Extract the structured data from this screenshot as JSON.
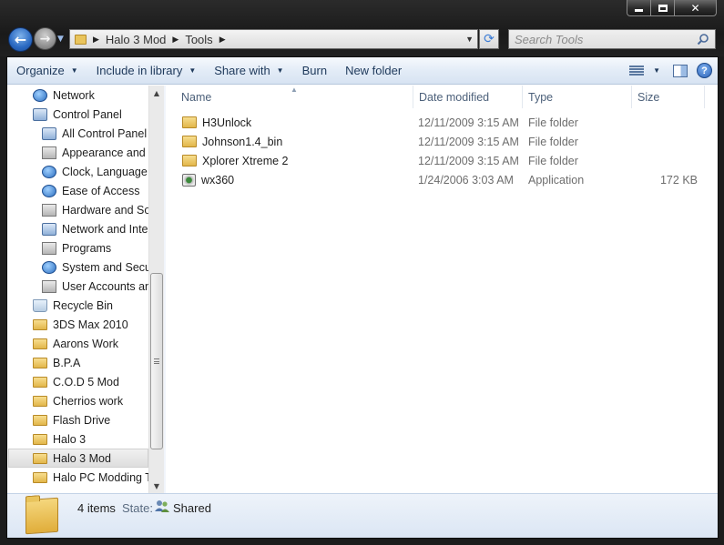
{
  "address": {
    "crumbs": [
      "Halo 3 Mod",
      "Tools"
    ]
  },
  "search": {
    "placeholder": "Search Tools"
  },
  "toolbar": {
    "organize": "Organize",
    "include_in_library": "Include in library",
    "share_with": "Share with",
    "burn": "Burn",
    "new_folder": "New folder"
  },
  "sidebar": {
    "items": [
      {
        "label": "Network",
        "icon": "network-icon"
      },
      {
        "label": "Control Panel",
        "icon": "control-panel-icon"
      },
      {
        "label": "All Control Panel I",
        "icon": "control-panel-icon"
      },
      {
        "label": "Appearance and P",
        "icon": "appearance-icon"
      },
      {
        "label": "Clock, Language,",
        "icon": "clock-icon"
      },
      {
        "label": "Ease of Access",
        "icon": "ease-of-access-icon"
      },
      {
        "label": "Hardware and Sou",
        "icon": "hardware-icon"
      },
      {
        "label": "Network and Inter",
        "icon": "network-icon"
      },
      {
        "label": "Programs",
        "icon": "programs-icon"
      },
      {
        "label": "System and Secur",
        "icon": "system-security-icon"
      },
      {
        "label": "User Accounts and",
        "icon": "user-accounts-icon"
      },
      {
        "label": "Recycle Bin",
        "icon": "recycle-bin-icon"
      },
      {
        "label": "3DS Max 2010",
        "icon": "folder-icon"
      },
      {
        "label": "Aarons Work",
        "icon": "folder-icon"
      },
      {
        "label": "B.P.A",
        "icon": "folder-icon"
      },
      {
        "label": "C.O.D 5 Mod",
        "icon": "folder-icon"
      },
      {
        "label": "Cherrios work",
        "icon": "folder-icon"
      },
      {
        "label": "Flash Drive",
        "icon": "folder-icon"
      },
      {
        "label": "Halo 3",
        "icon": "folder-icon"
      },
      {
        "label": "Halo 3 Mod",
        "icon": "folder-icon",
        "selected": true
      },
      {
        "label": "Halo PC Modding T",
        "icon": "folder-icon"
      }
    ]
  },
  "columns": {
    "name": "Name",
    "date_modified": "Date modified",
    "type": "Type",
    "size": "Size"
  },
  "files": [
    {
      "name": "H3Unlock",
      "date": "12/11/2009 3:15 AM",
      "type": "File folder",
      "size": "",
      "icon": "folder-icon"
    },
    {
      "name": "Johnson1.4_bin",
      "date": "12/11/2009 3:15 AM",
      "type": "File folder",
      "size": "",
      "icon": "folder-icon"
    },
    {
      "name": "Xplorer Xtreme 2",
      "date": "12/11/2009 3:15 AM",
      "type": "File folder",
      "size": "",
      "icon": "folder-icon"
    },
    {
      "name": "wx360",
      "date": "1/24/2006 3:03 AM",
      "type": "Application",
      "size": "172 KB",
      "icon": "application-icon"
    }
  ],
  "details": {
    "item_count": "4 items",
    "state_label": "State:",
    "state_value": "Shared"
  },
  "colors": {
    "accent": "#2a69c2",
    "toolbar_text": "#1e395b",
    "secondary_text": "#6d6d6d"
  }
}
